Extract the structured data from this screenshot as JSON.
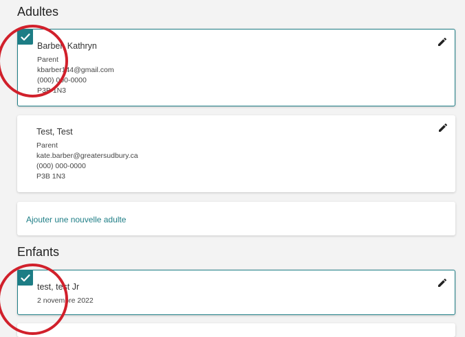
{
  "adults": {
    "title": "Adultes",
    "cards": [
      {
        "name": "Barber, Kathryn",
        "role": "Parent",
        "email": "kbarber144@gmail.com",
        "phone": "(000) 000-0000",
        "postal": "P3B 1N3",
        "selected": true
      },
      {
        "name": "Test, Test",
        "role": "Parent",
        "email": "kate.barber@greatersudbury.ca",
        "phone": "(000) 000-0000",
        "postal": "P3B 1N3",
        "selected": false
      }
    ],
    "add_label": "Ajouter une nouvelle adulte"
  },
  "children": {
    "title": "Enfants",
    "cards": [
      {
        "name": "test, test Jr",
        "dob": "2 novembre 2022",
        "selected": true
      }
    ]
  },
  "colors": {
    "accent": "#1d7d85",
    "annotation": "#d1202b"
  },
  "icons": {
    "edit": "pencil-icon",
    "check": "checkmark-icon"
  }
}
